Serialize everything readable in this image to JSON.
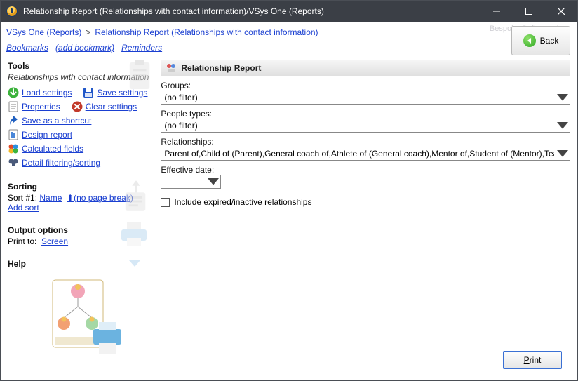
{
  "titlebar": {
    "title": "Relationship Report (Relationships with contact information)/VSys One (Reports)"
  },
  "breadcrumbs": {
    "root": "VSys One (Reports)",
    "current": "Relationship Report (Relationships with contact information)"
  },
  "watermark": "Bespoke Software, Inc.",
  "topbar": {
    "bookmarks": "Bookmarks",
    "add_bookmark": "(add bookmark)",
    "reminders": "Reminders"
  },
  "back_label": "Back",
  "sidebar": {
    "tools": {
      "heading": "Tools",
      "subtitle": "Relationships with contact information",
      "load": "Load settings",
      "save": "Save settings",
      "properties": "Properties",
      "clear": "Clear settings",
      "save_shortcut": "Save as a shortcut",
      "design": "Design report",
      "calculated": "Calculated fields",
      "filtering": "Detail filtering/sorting"
    },
    "sorting": {
      "heading": "Sorting",
      "prefix": "Sort #1:",
      "field": "Name",
      "arrow": "⬆",
      "pagebreak": "(no page break)",
      "add": "Add sort"
    },
    "output": {
      "heading": "Output options",
      "prefix": "Print to:",
      "target": "Screen"
    },
    "help_heading": "Help"
  },
  "panel": {
    "title": "Relationship Report",
    "groups_label": "Groups:",
    "groups_value": "(no filter)",
    "people_label": "People types:",
    "people_value": "(no filter)",
    "relationships_label": "Relationships:",
    "relationships_value": "Parent of,Child of (Parent),General coach of,Athlete of (General coach),Mentor of,Student of (Mentor),Teach",
    "effective_label": "Effective date:",
    "effective_value": "",
    "include_expired": "Include expired/inactive relationships"
  },
  "footer": {
    "print_letter": "P",
    "print_rest": "rint"
  }
}
